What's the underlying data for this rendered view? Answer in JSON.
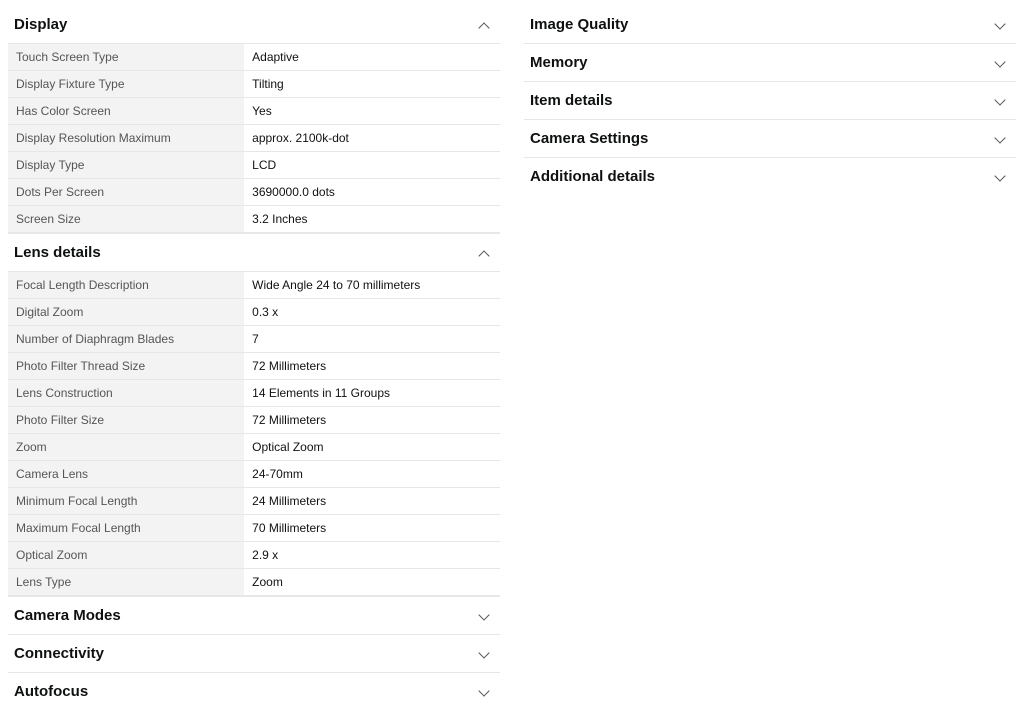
{
  "left_sections": [
    {
      "title": "Display",
      "expanded": true,
      "rows": [
        {
          "label": "Touch Screen Type",
          "value": "Adaptive"
        },
        {
          "label": "Display Fixture Type",
          "value": "Tilting"
        },
        {
          "label": "Has Color Screen",
          "value": "Yes"
        },
        {
          "label": "Display Resolution Maximum",
          "value": "approx. 2100k-dot"
        },
        {
          "label": "Display Type",
          "value": "LCD"
        },
        {
          "label": "Dots Per Screen",
          "value": "3690000.0 dots"
        },
        {
          "label": "Screen Size",
          "value": "3.2 Inches"
        }
      ]
    },
    {
      "title": "Lens details",
      "expanded": true,
      "rows": [
        {
          "label": "Focal Length Description",
          "value": "Wide Angle 24 to 70 millimeters"
        },
        {
          "label": "Digital Zoom",
          "value": "0.3 x"
        },
        {
          "label": "Number of Diaphragm Blades",
          "value": "7"
        },
        {
          "label": "Photo Filter Thread Size",
          "value": "72 Millimeters"
        },
        {
          "label": "Lens Construction",
          "value": "14 Elements in 11 Groups"
        },
        {
          "label": "Photo Filter Size",
          "value": "72 Millimeters"
        },
        {
          "label": "Zoom",
          "value": "Optical Zoom"
        },
        {
          "label": "Camera Lens",
          "value": "24-70mm"
        },
        {
          "label": "Minimum Focal Length",
          "value": "24 Millimeters"
        },
        {
          "label": "Maximum Focal Length",
          "value": "70 Millimeters"
        },
        {
          "label": "Optical Zoom",
          "value": "2.9 x"
        },
        {
          "label": "Lens Type",
          "value": "Zoom"
        }
      ]
    },
    {
      "title": "Camera Modes",
      "expanded": false
    },
    {
      "title": "Connectivity",
      "expanded": false
    },
    {
      "title": "Autofocus",
      "expanded": false
    }
  ],
  "right_sections": [
    {
      "title": "Image Quality",
      "expanded": false
    },
    {
      "title": "Memory",
      "expanded": false
    },
    {
      "title": "Item details",
      "expanded": false
    },
    {
      "title": "Camera Settings",
      "expanded": false
    },
    {
      "title": "Additional details",
      "expanded": false
    }
  ]
}
